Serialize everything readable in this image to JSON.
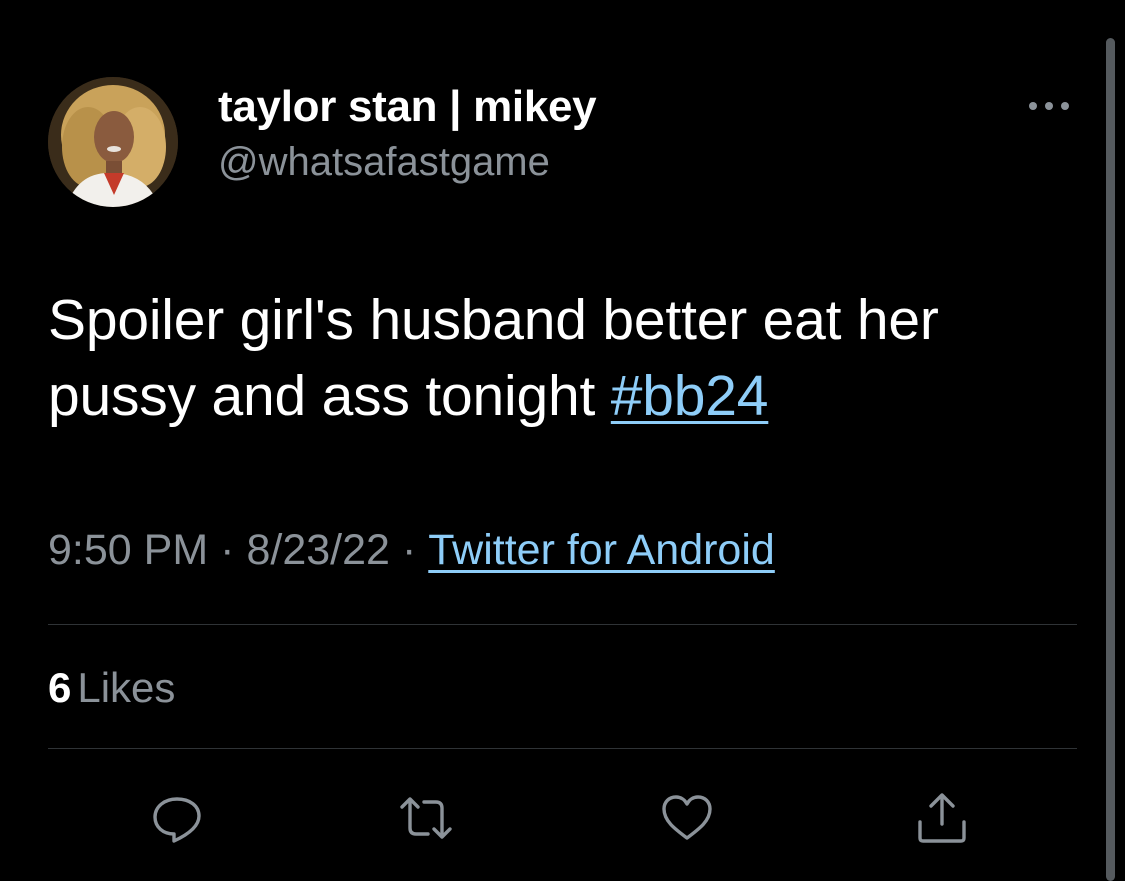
{
  "author": {
    "display_name": "taylor stan | mikey",
    "handle": "@whatsafastgame",
    "avatar_icon": "profile-photo"
  },
  "tweet": {
    "text_before": "Spoiler girl's husband better eat her pussy and ass tonight ",
    "hashtag": "#bb24"
  },
  "meta": {
    "time": "9:50 PM",
    "separator": "·",
    "date": "8/23/22",
    "source": "Twitter for Android"
  },
  "stats": {
    "likes_count": "6",
    "likes_label": "Likes"
  },
  "actions": [
    {
      "icon": "reply-icon"
    },
    {
      "icon": "retweet-icon"
    },
    {
      "icon": "like-icon"
    },
    {
      "icon": "share-icon"
    }
  ],
  "colors": {
    "background": "#000000",
    "primary_text": "#ffffff",
    "secondary_text": "#8b9299",
    "link": "#8ecdf8",
    "divider": "#2f3336"
  }
}
